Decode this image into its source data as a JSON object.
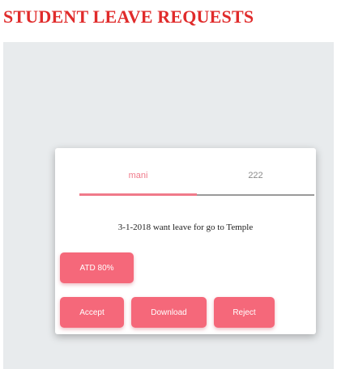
{
  "page": {
    "title": "STUDENT LEAVE REQUESTS"
  },
  "tabs": [
    {
      "label": "mani",
      "active": true
    },
    {
      "label": "222",
      "active": false
    }
  ],
  "request": {
    "message": "3-1-2018 want leave for go to Temple",
    "attendance_label": "ATD 80%"
  },
  "actions": {
    "accept_label": "Accept",
    "download_label": "Download",
    "reject_label": "Reject"
  },
  "colors": {
    "title": "#e02b2b",
    "accent": "#f07a8a",
    "button": "#f5687a",
    "panel": "#e8ebed"
  }
}
